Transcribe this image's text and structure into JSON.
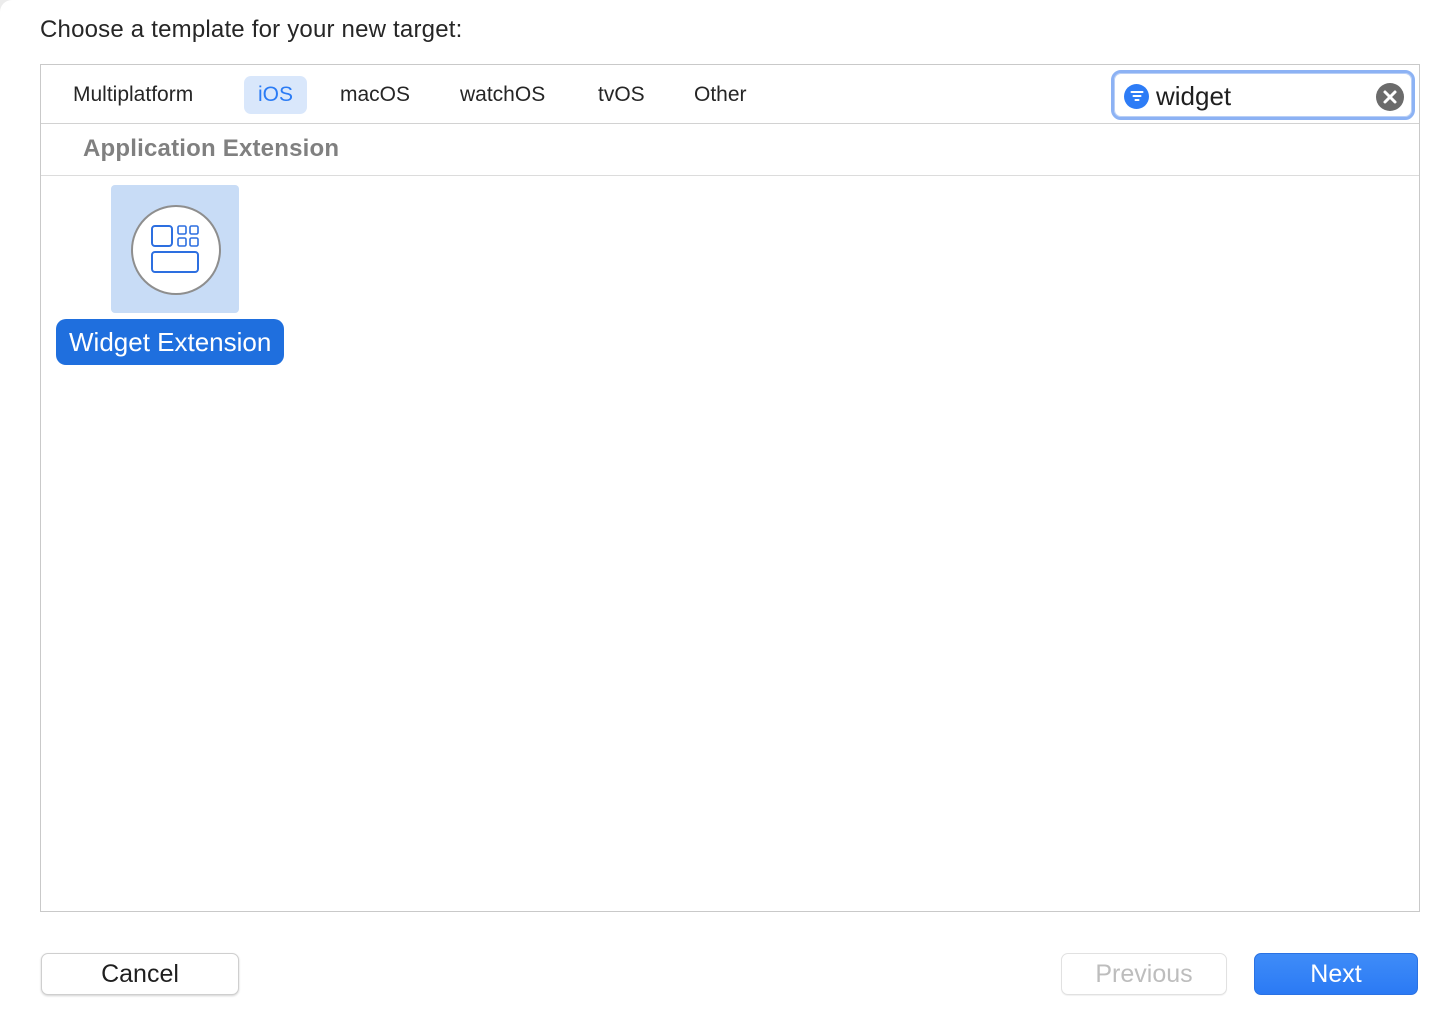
{
  "dialog": {
    "prompt": "Choose a template for your new target:"
  },
  "platform_tabs": [
    {
      "label": "Multiplatform",
      "selected": false
    },
    {
      "label": "iOS",
      "selected": true
    },
    {
      "label": "macOS",
      "selected": false
    },
    {
      "label": "watchOS",
      "selected": false
    },
    {
      "label": "tvOS",
      "selected": false
    },
    {
      "label": "Other",
      "selected": false
    }
  ],
  "search": {
    "value": "widget",
    "filter_icon": "filter-icon",
    "clear_icon": "clear-icon"
  },
  "sections": [
    {
      "title": "Application Extension",
      "templates": [
        {
          "label": "Widget Extension",
          "icon": "widget-extension-icon",
          "selected": true
        }
      ]
    }
  ],
  "buttons": {
    "cancel": "Cancel",
    "previous": "Previous",
    "next": "Next"
  },
  "colors": {
    "accent": "#2b7af4",
    "selection": "#1f6fde",
    "tab_selected_bg": "#d9e7fb",
    "tile_selected_bg": "#c8dcf6"
  }
}
